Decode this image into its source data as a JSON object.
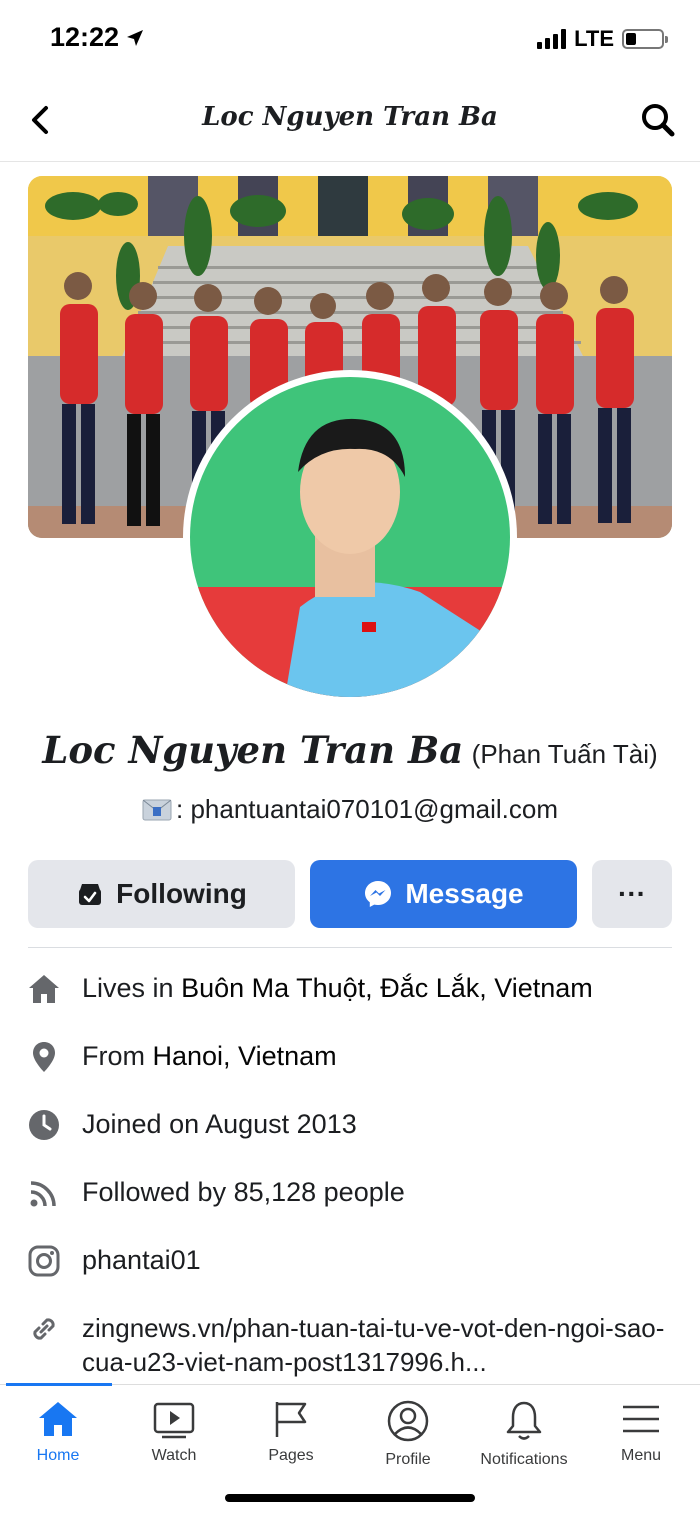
{
  "status": {
    "time": "12:22",
    "network": "LTE"
  },
  "header": {
    "title": "Loc Nguyen Tran Ba"
  },
  "profile": {
    "name": "Loc Nguyen Tran Ba",
    "alt_name": "(Phan Tuấn Tài)",
    "email_text": ": phantuantai070101@gmail.com"
  },
  "actions": {
    "following_label": "Following",
    "message_label": "Message",
    "more_label": "···"
  },
  "details": {
    "lives_prefix": "Lives in ",
    "lives_place": "Buôn Ma Thuột, Đắc Lắk, Vietnam",
    "from_prefix": "From ",
    "from_place": "Hanoi, Vietnam",
    "joined": "Joined on August 2013",
    "followers": "Followed by 85,128 people",
    "instagram": "phantai01",
    "link": "zingnews.vn/phan-tuan-tai-tu-ve-vot-den-ngoi-sao-cua-u23-viet-nam-post1317996.h..."
  },
  "icons": {
    "back": "chevron-left-icon",
    "search": "search-icon",
    "email": "email-emoji-icon",
    "following": "following-check-icon",
    "message": "messenger-icon",
    "lives": "home-icon",
    "from": "location-pin-icon",
    "joined": "clock-icon",
    "followers": "rss-icon",
    "instagram": "instagram-icon",
    "link": "link-icon"
  },
  "colors": {
    "brand_blue": "#1877f2",
    "message_button": "#2d74e4",
    "secondary_button": "#e4e6eb"
  },
  "nav": [
    {
      "label": "Home",
      "icon": "home-icon",
      "active": true
    },
    {
      "label": "Watch",
      "icon": "watch-icon",
      "active": false
    },
    {
      "label": "Pages",
      "icon": "flag-icon",
      "active": false
    },
    {
      "label": "Profile",
      "icon": "profile-icon",
      "active": false
    },
    {
      "label": "Notifications",
      "icon": "bell-icon",
      "active": false
    },
    {
      "label": "Menu",
      "icon": "menu-icon",
      "active": false
    }
  ]
}
